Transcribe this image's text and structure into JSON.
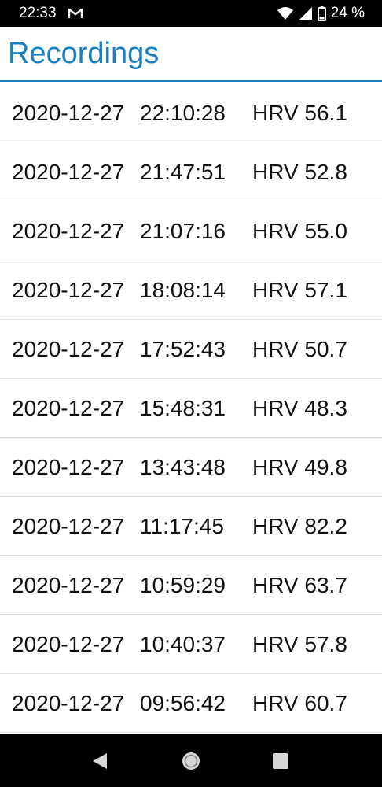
{
  "status_bar": {
    "time": "22:33",
    "battery": "24 %",
    "icons": [
      "gmail-icon",
      "wifi-icon",
      "cellular-signal-icon",
      "battery-icon"
    ]
  },
  "header": {
    "title": "Recordings"
  },
  "recordings": [
    {
      "date": "2020-12-27",
      "time": "22:10:28",
      "hrv": "HRV 56.1"
    },
    {
      "date": "2020-12-27",
      "time": "21:47:51",
      "hrv": "HRV 52.8"
    },
    {
      "date": "2020-12-27",
      "time": "21:07:16",
      "hrv": "HRV 55.0"
    },
    {
      "date": "2020-12-27",
      "time": "18:08:14",
      "hrv": "HRV 57.1"
    },
    {
      "date": "2020-12-27",
      "time": "17:52:43",
      "hrv": "HRV 50.7"
    },
    {
      "date": "2020-12-27",
      "time": "15:48:31",
      "hrv": "HRV 48.3"
    },
    {
      "date": "2020-12-27",
      "time": "13:43:48",
      "hrv": "HRV 49.8"
    },
    {
      "date": "2020-12-27",
      "time": "11:17:45",
      "hrv": "HRV 82.2"
    },
    {
      "date": "2020-12-27",
      "time": "10:59:29",
      "hrv": "HRV 63.7"
    },
    {
      "date": "2020-12-27",
      "time": "10:40:37",
      "hrv": "HRV 57.8"
    },
    {
      "date": "2020-12-27",
      "time": "09:56:42",
      "hrv": "HRV 60.7"
    }
  ],
  "nav_bar": {
    "icons": [
      "back-icon",
      "home-icon",
      "recent-apps-icon"
    ]
  },
  "colors": {
    "accent": "#1a7fc1",
    "status_bar": "#000000",
    "text": "#111111",
    "divider": "#e3e3e3"
  }
}
